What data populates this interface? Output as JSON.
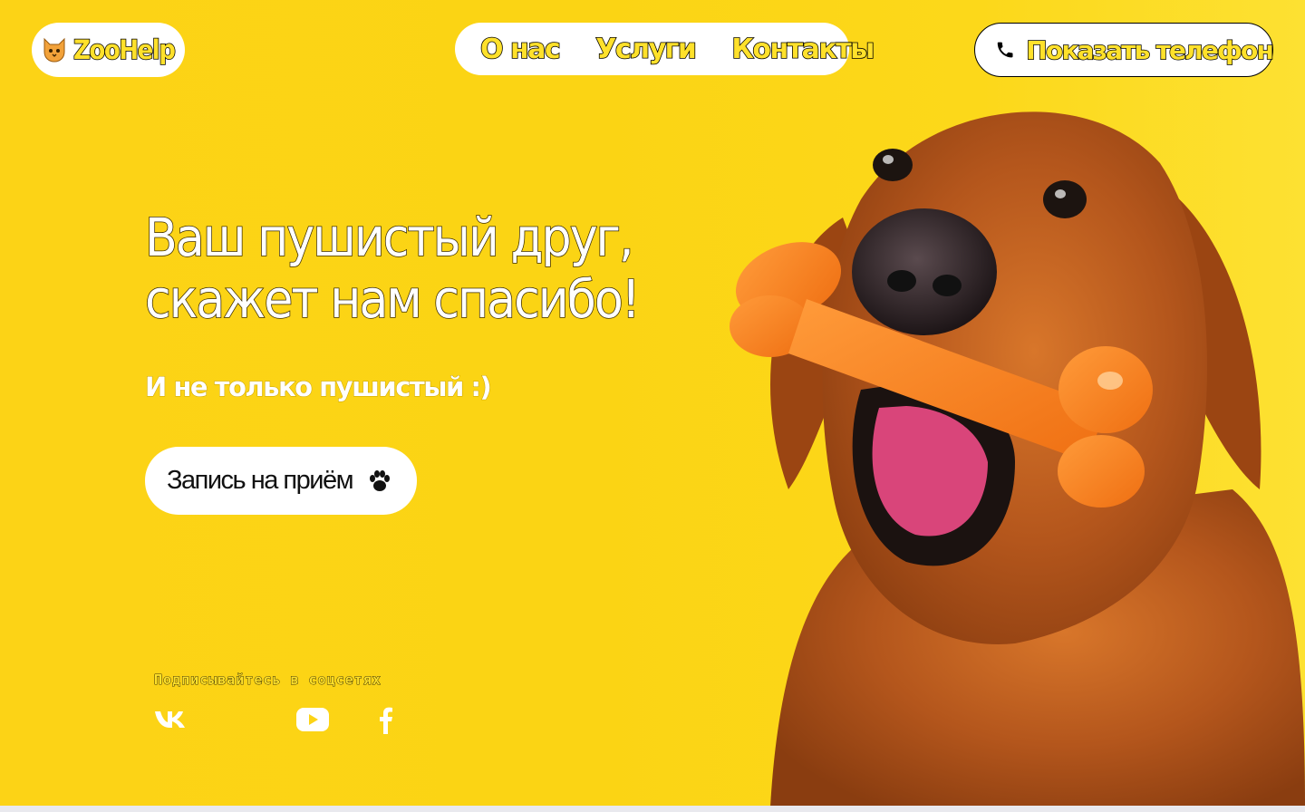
{
  "header": {
    "logo": {
      "icon": "cat-face-icon",
      "text": "ZooHelp"
    },
    "nav": [
      {
        "label": "О нас"
      },
      {
        "label": "Услуги"
      },
      {
        "label": "Контакты"
      }
    ],
    "phone_button": {
      "icon": "phone-icon",
      "label": "Показать телефон"
    }
  },
  "hero": {
    "title": "Ваш пушистый друг,\nскажет нам спасибо!",
    "subtitle": "И не только пушистый :)",
    "cta": {
      "label": "Запись на приём",
      "icon": "paw-icon"
    },
    "image": "golden-retriever-with-orange-bone"
  },
  "socials": {
    "caption": "Подписывайтесь в соцсетях",
    "links": [
      {
        "icon": "vk-icon"
      },
      {
        "icon": "youtube-icon"
      },
      {
        "icon": "facebook-icon"
      }
    ]
  },
  "colors": {
    "background": "#fcd316",
    "pill": "#ffffff",
    "outline_text": "#ffe12b"
  }
}
